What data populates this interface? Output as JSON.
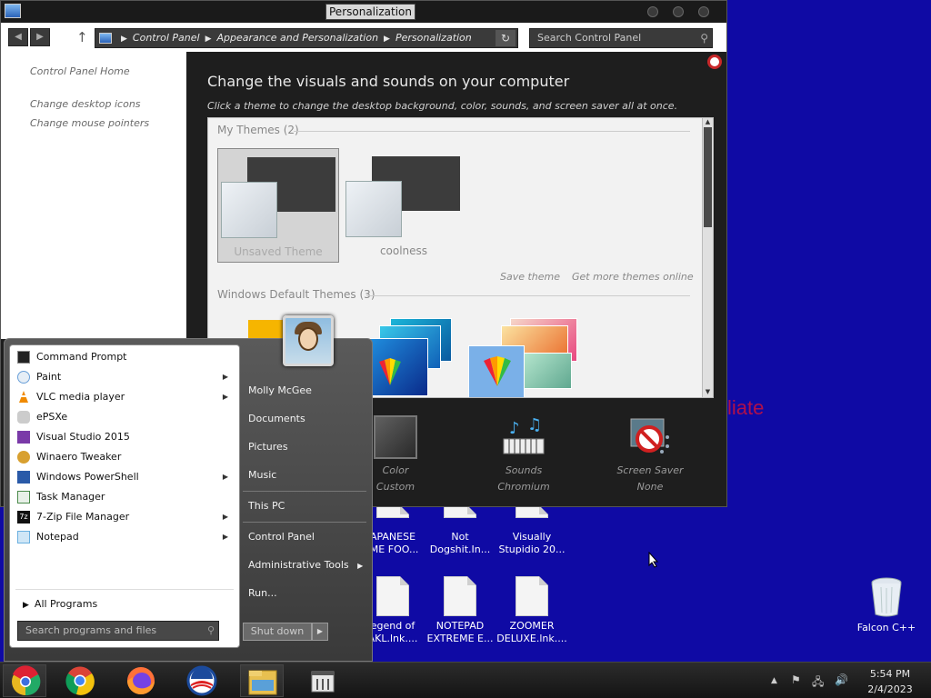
{
  "window": {
    "title": "Personalization",
    "breadcrumb": [
      "Control Panel",
      "Appearance and Personalization",
      "Personalization"
    ],
    "search_placeholder": "Search Control Panel"
  },
  "left_pane": {
    "home_link": "Control Panel Home",
    "links": [
      "Change desktop icons",
      "Change mouse pointers"
    ]
  },
  "main": {
    "heading": "Change the visuals and sounds on your computer",
    "subheading": "Click a theme to change the desktop background, color, sounds, and screen saver all at once.",
    "my_themes_label": "My Themes (2)",
    "my_themes": [
      "Unsaved Theme",
      "coolness"
    ],
    "save_theme": "Save theme",
    "get_more": "Get more themes online",
    "default_themes_label": "Windows Default Themes (3)",
    "bottom": [
      {
        "label": "Color",
        "value": "Custom",
        "icon": "color-icon"
      },
      {
        "label": "Sounds",
        "value": "Chromium",
        "icon": "sounds-icon"
      },
      {
        "label": "Screen Saver",
        "value": "None",
        "icon": "screensaver-icon"
      }
    ]
  },
  "desktop": {
    "partial_text": "liate",
    "icons_row1": [
      "APANESE\nIME FOO...",
      "Not\nDogshit.In...",
      "Visually\nStupidio 20..."
    ],
    "icons_row2": [
      "egend of\nAKL.lnk....",
      "NOTEPAD\nEXTREME E...",
      "ZOOMER\nDELUXE.lnk...."
    ],
    "recycle_bin": "Falcon C++"
  },
  "start_menu": {
    "programs": [
      {
        "label": "Command Prompt",
        "submenu": false,
        "icon": "cmd-icon",
        "color": "#222222"
      },
      {
        "label": "Paint",
        "submenu": true,
        "icon": "paint-icon",
        "color": "#6aa0d8"
      },
      {
        "label": "VLC media player",
        "submenu": true,
        "icon": "vlc-icon",
        "color": "#f08a00"
      },
      {
        "label": "ePSXe",
        "submenu": false,
        "icon": "gamepad-icon",
        "color": "#888888"
      },
      {
        "label": "Visual Studio 2015",
        "submenu": false,
        "icon": "visual-studio-icon",
        "color": "#7a3aa8"
      },
      {
        "label": "Winaero Tweaker",
        "submenu": false,
        "icon": "winaero-icon",
        "color": "#d8a030"
      },
      {
        "label": "Windows PowerShell",
        "submenu": true,
        "icon": "powershell-icon",
        "color": "#2a5aa8"
      },
      {
        "label": "Task Manager",
        "submenu": false,
        "icon": "task-manager-icon",
        "color": "#4a8a4a"
      },
      {
        "label": "7-Zip File Manager",
        "submenu": true,
        "icon": "7zip-icon",
        "color": "#111111"
      },
      {
        "label": "Notepad",
        "submenu": true,
        "icon": "notepad-icon",
        "color": "#6ab0e0"
      }
    ],
    "all_programs": "All Programs",
    "search_placeholder": "Search programs and files",
    "right_items": [
      "Molly McGee",
      "Documents",
      "Pictures",
      "Music",
      "This PC",
      "Control Panel",
      "Administrative Tools",
      "Run..."
    ],
    "shutdown": "Shut down"
  },
  "taskbar": {
    "apps": [
      "chrome-canary-icon",
      "chrome-icon",
      "firefox-icon",
      "obama-icon",
      "file-explorer-icon",
      "control-panel-icon"
    ],
    "time": "5:54 PM",
    "date": "2/4/2023"
  }
}
